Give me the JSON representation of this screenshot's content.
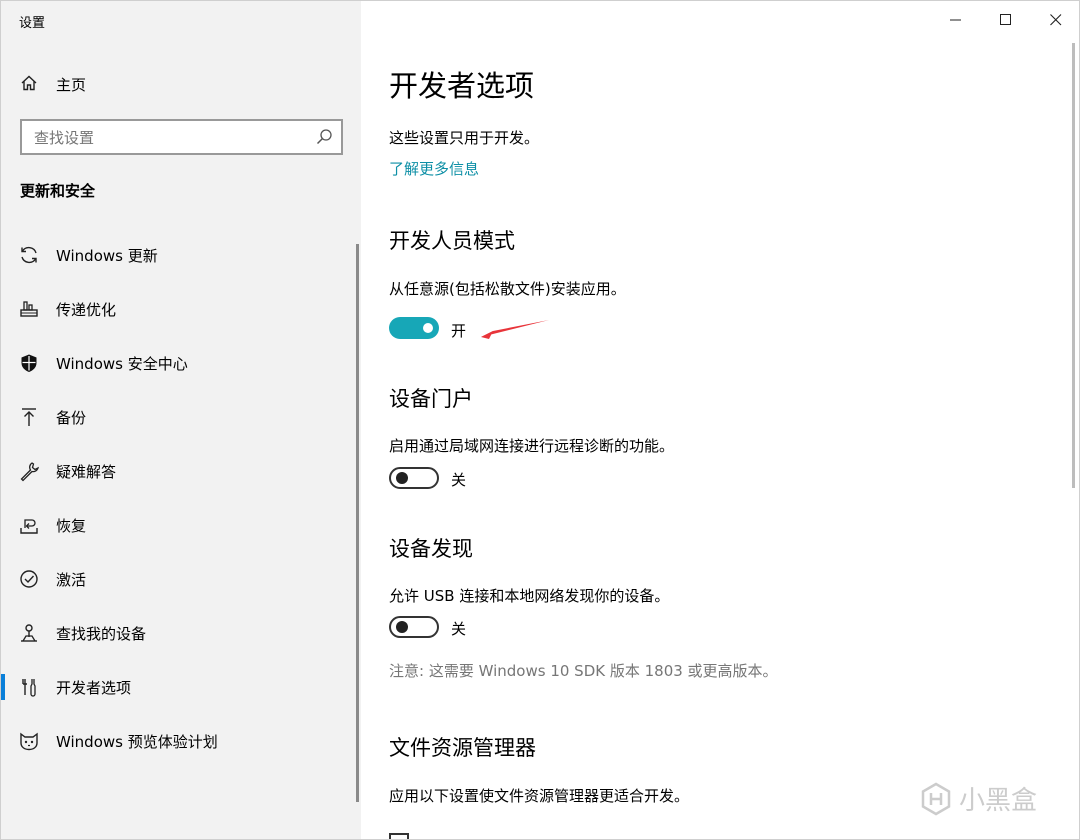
{
  "window": {
    "title": "设置"
  },
  "sidebar": {
    "home_label": "主页",
    "search_placeholder": "查找设置",
    "section_heading": "更新和安全",
    "items": [
      {
        "label": "Windows 更新",
        "icon": "sync-icon"
      },
      {
        "label": "传递优化",
        "icon": "delivery-optimization-icon"
      },
      {
        "label": "Windows 安全中心",
        "icon": "shield-icon"
      },
      {
        "label": "备份",
        "icon": "backup-arrow-icon"
      },
      {
        "label": "疑难解答",
        "icon": "wrench-icon"
      },
      {
        "label": "恢复",
        "icon": "recovery-icon"
      },
      {
        "label": "激活",
        "icon": "check-circle-icon"
      },
      {
        "label": "查找我的设备",
        "icon": "find-device-icon"
      },
      {
        "label": "开发者选项",
        "icon": "developer-tools-icon",
        "active": true
      },
      {
        "label": "Windows 预览体验计划",
        "icon": "insider-cat-icon"
      }
    ]
  },
  "main": {
    "title": "开发者选项",
    "intro": "这些设置只用于开发。",
    "learn_more": "了解更多信息",
    "developer_mode": {
      "heading": "开发人员模式",
      "description": "从任意源(包括松散文件)安装应用。",
      "state": "开",
      "on": true
    },
    "device_portal": {
      "heading": "设备门户",
      "description": "启用通过局域网连接进行远程诊断的功能。",
      "state": "关",
      "on": false
    },
    "device_discovery": {
      "heading": "设备发现",
      "description": "允许 USB 连接和本地网络发现你的设备。",
      "state": "关",
      "on": false,
      "note": "注意: 这需要 Windows 10 SDK 版本 1803 或更高版本。"
    },
    "file_explorer": {
      "heading": "文件资源管理器",
      "description": "应用以下设置使文件资源管理器更适合开发。"
    }
  },
  "watermark": {
    "text": "小黑盒"
  },
  "colors": {
    "accent": "#17a7b7",
    "link": "#0d8fa6",
    "active_indicator": "#0a7fd9",
    "annotation_arrow": "#e8343a"
  }
}
